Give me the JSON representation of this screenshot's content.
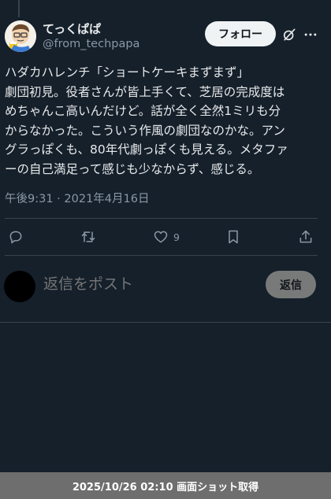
{
  "author": {
    "name": "てっくぱぱ",
    "handle": "@from_techpapa"
  },
  "header": {
    "follow_label": "フォロー"
  },
  "tweet": {
    "text": "ハダカハレンチ「ショートケーキまずまず」\n劇団初見。役者さんが皆上手くて、芝居の完成度は\nめちゃんこ高いんだけど。話が全く全然1ミリも分\nからなかった。こういう作風の劇団なのかな。アン\nグラっぽくも、80年代劇っぽくも見える。メタファ\nーの自己満足って感じも少なからず、感じる。",
    "timestamp": "午後9:31 · 2021年4月16日",
    "like_count": "9"
  },
  "actions": {
    "reply_icon": "reply-icon",
    "retweet_icon": "retweet-icon",
    "like_icon": "heart-icon",
    "bookmark_icon": "bookmark-icon",
    "share_icon": "share-icon"
  },
  "reply_box": {
    "placeholder": "返信をポスト",
    "button_label": "返信"
  },
  "footer": {
    "capture_text": "2025/10/26 02:10 画面ショット取得"
  },
  "colors": {
    "background": "#15202b",
    "text": "#e7e9ea",
    "muted": "#8b98a5",
    "divider": "#38444d",
    "follow_button": "#eff3f4",
    "reply_button": "#787a7a",
    "footer_bar": "#6e6e6e"
  }
}
